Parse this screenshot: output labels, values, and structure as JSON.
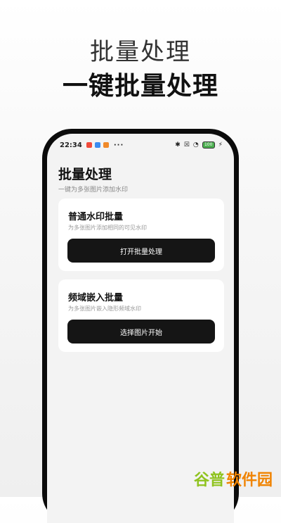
{
  "promo": {
    "subtitle": "批量处理",
    "title": "一键批量处理"
  },
  "status_bar": {
    "time": "22:34",
    "app_icons": [
      {
        "name": "app-icon-red",
        "color": "#f04a3a"
      },
      {
        "name": "app-icon-blue",
        "color": "#3a8cf0"
      },
      {
        "name": "app-icon-orange",
        "color": "#f08a2a"
      }
    ],
    "more": "···",
    "battery": "100"
  },
  "app": {
    "title": "批量处理",
    "subtitle": "一键为多张图片添加水印",
    "cards": [
      {
        "title": "普通水印批量",
        "description": "为多张图片添加相同的可见水印",
        "button": "打开批量处理"
      },
      {
        "title": "频域嵌入批量",
        "description": "为多张图片嵌入隐形频域水印",
        "button": "选择图片开始"
      }
    ]
  },
  "watermark": {
    "part1": "谷普",
    "part2": "软件园"
  }
}
